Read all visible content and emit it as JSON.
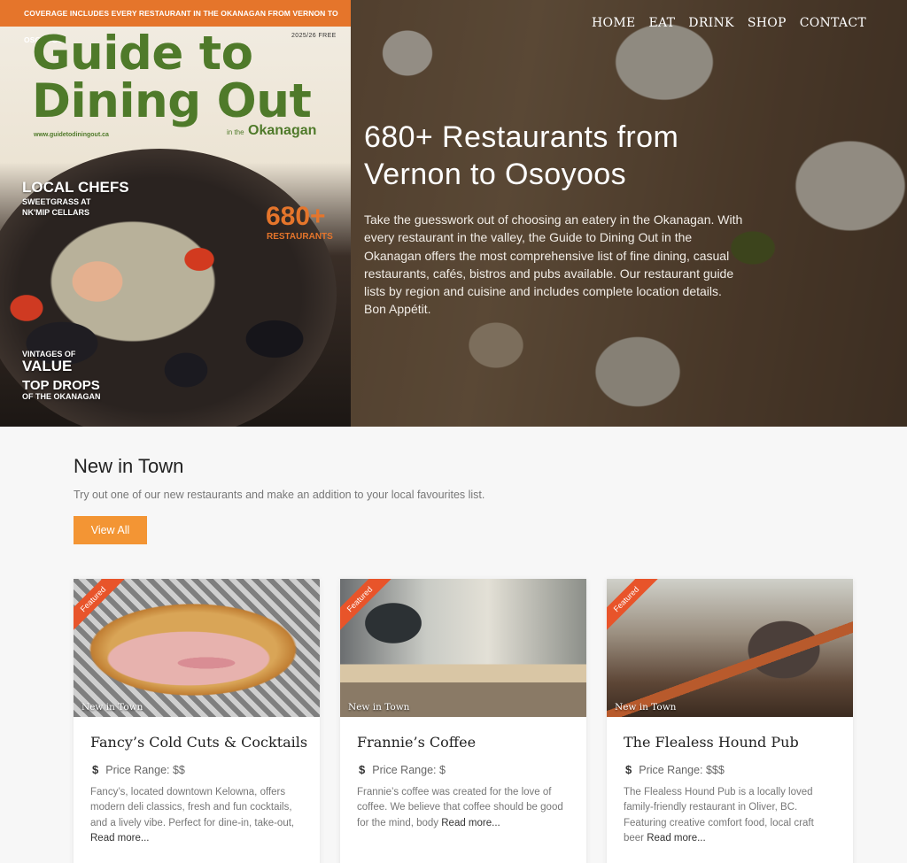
{
  "nav": [
    "HOME",
    "EAT",
    "DRINK",
    "SHOP",
    "CONTACT"
  ],
  "cover": {
    "bar": "COVERAGE INCLUDES EVERY RESTAURANT IN THE OKANAGAN FROM VERNON TO OSOYOOS",
    "issue": "2025/26  FREE",
    "title_line1": "Guide to",
    "title_line2": "Dining Out",
    "url": "www.guidetodiningout.ca",
    "sub_small": "in the",
    "sub": "Okanagan",
    "chefs": "LOCAL CHEFS",
    "chefs_sub1": "SWEETGRASS AT",
    "chefs_sub2": "NK'MIP CELLARS",
    "count": "680+",
    "count_label": "RESTAURANTS",
    "vintages": "VINTAGES OF",
    "value": "VALUE",
    "drops": "TOP DROPS",
    "okanagan": "OF THE OKANAGAN"
  },
  "hero": {
    "title": "680+ Restaurants from Vernon to Osoyoos",
    "body": "Take the guesswork out of choosing an eatery in the Okanagan. With every restaurant in the valley, the Guide to Dining Out in the Okanagan offers the most comprehensive list of fine dining, casual restaurants, cafés, bistros and pubs available. Our restaurant guide lists by region and cuisine and includes complete location details. Bon Appétit."
  },
  "new_in_town": {
    "title": "New in Town",
    "subtitle": "Try out one of our new restaurants and make an addition to your local favourites list.",
    "button": "View All"
  },
  "cards": [
    {
      "ribbon": "Featured",
      "tag": "New in Town",
      "name": "Fancy’s Cold Cuts & Cocktails",
      "price": "Price Range: $$",
      "desc": "Fancy’s, located downtown Kelowna, offers modern deli classics, fresh and fun cocktails, and a lively vibe. Perfect for dine-in, take-out, ",
      "more": "Read more..."
    },
    {
      "ribbon": "Featured",
      "tag": "New in Town",
      "name": "Frannie’s Coffee",
      "price": "Price Range: $",
      "desc": "Frannie’s coffee was created for the love of coffee. We believe that coffee should be good for the mind, body ",
      "more": "Read more..."
    },
    {
      "ribbon": "Featured",
      "tag": "New in Town",
      "name": "The Flealess Hound Pub",
      "price": "Price Range: $$$",
      "desc": "The Flealess Hound Pub is a locally loved family-friendly restaurant in Oliver, BC. Featuring creative comfort food, local craft beer ",
      "more": "Read more..."
    }
  ],
  "colors": {
    "accent_orange": "#f39534",
    "cover_green": "#4f7a2a",
    "ribbon_red": "#e8542a"
  }
}
